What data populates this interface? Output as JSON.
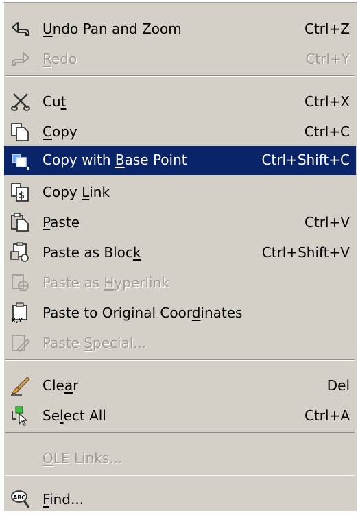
{
  "menu": {
    "items": [
      {
        "pre": "",
        "ul": "U",
        "post": "ndo Pan and Zoom",
        "shortcut": "Ctrl+Z",
        "icon": "undo-icon",
        "state": "enabled"
      },
      {
        "pre": "",
        "ul": "R",
        "post": "edo",
        "shortcut": "Ctrl+Y",
        "icon": "redo-icon",
        "state": "disabled"
      },
      {
        "pre": "Cu",
        "ul": "t",
        "post": "",
        "shortcut": "Ctrl+X",
        "icon": "scissors-icon",
        "state": "enabled"
      },
      {
        "pre": "",
        "ul": "C",
        "post": "opy",
        "shortcut": "Ctrl+C",
        "icon": "copy-icon",
        "state": "enabled"
      },
      {
        "pre": "Copy with ",
        "ul": "B",
        "post": "ase Point",
        "shortcut": "Ctrl+Shift+C",
        "icon": "copy-base-point-icon",
        "state": "selected"
      },
      {
        "pre": "Copy ",
        "ul": "L",
        "post": "ink",
        "shortcut": "",
        "icon": "copy-link-icon",
        "state": "enabled"
      },
      {
        "pre": "",
        "ul": "P",
        "post": "aste",
        "shortcut": "Ctrl+V",
        "icon": "paste-icon",
        "state": "enabled"
      },
      {
        "pre": "Paste as Bloc",
        "ul": "k",
        "post": "",
        "shortcut": "Ctrl+Shift+V",
        "icon": "paste-block-icon",
        "state": "enabled"
      },
      {
        "pre": "Paste as ",
        "ul": "H",
        "post": "yperlink",
        "shortcut": "",
        "icon": "paste-hyperlink-icon",
        "state": "disabled"
      },
      {
        "pre": "Paste to Original Coor",
        "ul": "d",
        "post": "inates",
        "shortcut": "",
        "icon": "paste-coordinates-icon",
        "state": "enabled"
      },
      {
        "pre": "Paste ",
        "ul": "S",
        "post": "pecial...",
        "shortcut": "",
        "icon": "paste-special-icon",
        "state": "disabled"
      },
      {
        "pre": "Cle",
        "ul": "a",
        "post": "r",
        "shortcut": "Del",
        "icon": "eraser-icon",
        "state": "enabled"
      },
      {
        "pre": "Se",
        "ul": "l",
        "post": "ect All",
        "shortcut": "Ctrl+A",
        "icon": "select-all-icon",
        "state": "enabled"
      },
      {
        "pre": "",
        "ul": "O",
        "post": "LE Links...",
        "shortcut": "",
        "icon": "",
        "state": "disabled"
      },
      {
        "pre": "",
        "ul": "F",
        "post": "ind...",
        "shortcut": "",
        "icon": "find-icon",
        "state": "enabled"
      }
    ],
    "colors": {
      "menu_bg": "#d4d0c8",
      "highlight": "#0a246a",
      "disabled_text": "#a09c95"
    }
  }
}
